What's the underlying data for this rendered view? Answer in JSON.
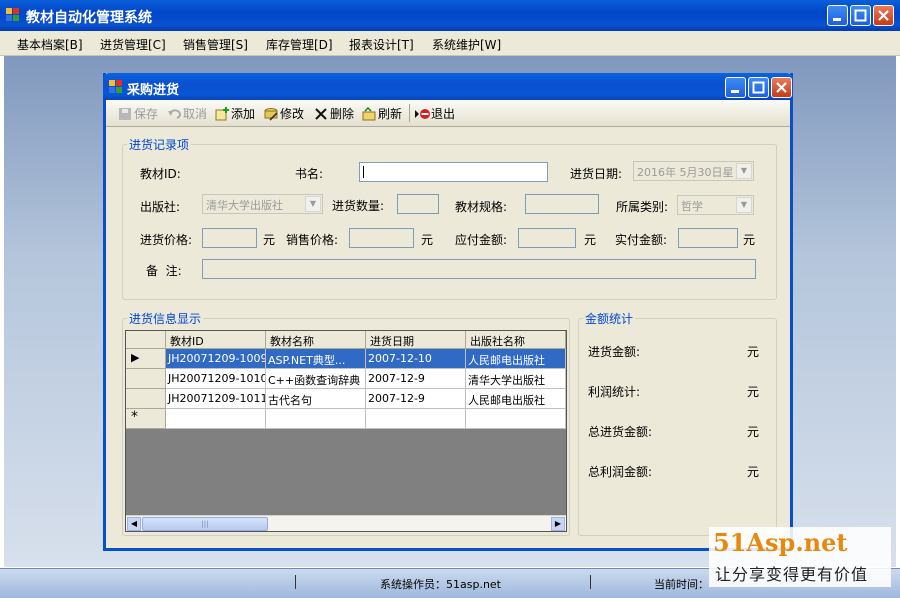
{
  "app": {
    "title": "教材自动化管理系统",
    "menu": [
      "基本档案[B]",
      "进货管理[C]",
      "销售管理[S]",
      "库存管理[D]",
      "报表设计[T]",
      "系统维护[W]"
    ]
  },
  "child": {
    "title": "采购进货",
    "toolbar": {
      "save": "保存",
      "cancel": "取消",
      "add": "添加",
      "edit": "修改",
      "delete": "删除",
      "refresh": "刷新",
      "exit": "退出"
    }
  },
  "form": {
    "group_title": "进货记录项",
    "book_id_label": "教材ID:",
    "book_name_label": "书名:",
    "date_label": "进货日期:",
    "date_value": "2016年 5月30日星",
    "publisher_label": "出版社:",
    "publisher_value": "清华大学出版社",
    "qty_label": "进货数量:",
    "spec_label": "教材规格:",
    "category_label": "所属类别:",
    "category_value": "哲学",
    "purchase_price_label": "进货价格:",
    "sale_price_label": "销售价格:",
    "payable_label": "应付金额:",
    "paid_label": "实付金额:",
    "yuan": "元",
    "remark_label": "备  注:"
  },
  "grid": {
    "group_title": "进货信息显示",
    "columns": [
      "教材ID",
      "教材名称",
      "进货日期",
      "出版社名称"
    ],
    "rows": [
      [
        "JH20071209-1009",
        "ASP.NET典型...",
        "2007-12-10",
        "人民邮电出版社"
      ],
      [
        "JH20071209-1010",
        "C++函数查询辞典",
        "2007-12-9",
        "清华大学出版社"
      ],
      [
        "JH20071209-1011",
        "古代名句",
        "2007-12-9",
        "人民邮电出版社"
      ]
    ],
    "current_row_marker": "▶",
    "new_row_marker": "*",
    "scroll_thumb_glyph": "|||"
  },
  "stats": {
    "group_title": "金额统计",
    "items": [
      {
        "label": "进货金额:",
        "unit": "元"
      },
      {
        "label": "利润统计:",
        "unit": "元"
      },
      {
        "label": "总进货金额:",
        "unit": "元"
      },
      {
        "label": "总利润金额:",
        "unit": "元"
      }
    ]
  },
  "status": {
    "operator": "系统操作员：51asp.net",
    "time_label": "当前时间："
  },
  "watermark": {
    "brand": "51Asp.net",
    "slogan": "让分享变得更有价值"
  }
}
